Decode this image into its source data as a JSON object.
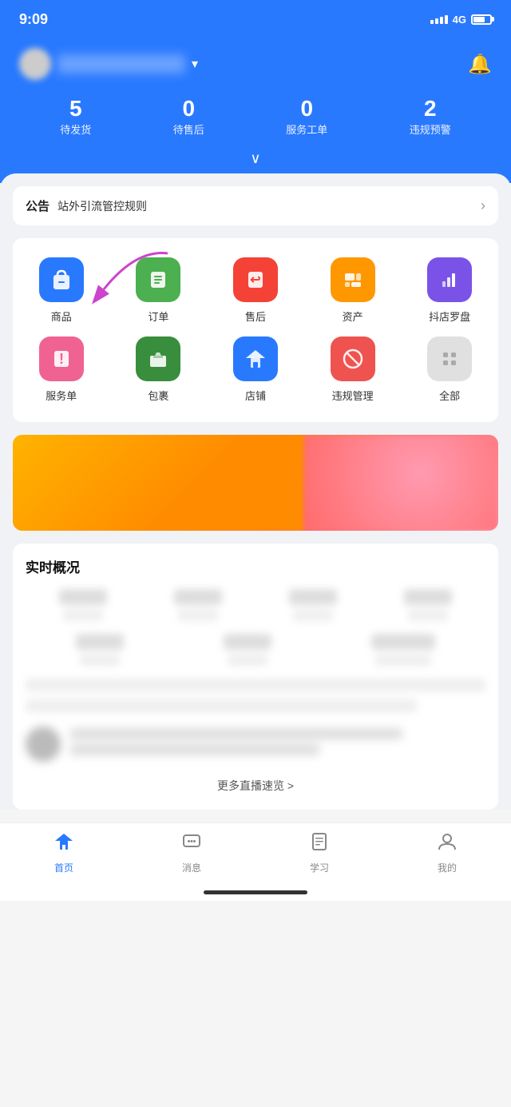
{
  "statusBar": {
    "time": "9:09",
    "signal": "4G"
  },
  "header": {
    "shopName": "店铺名称",
    "notificationAriaLabel": "通知",
    "chevronLabel": "展开"
  },
  "stats": [
    {
      "key": "pending_ship",
      "num": "5",
      "label": "待发货"
    },
    {
      "key": "pending_after",
      "num": "0",
      "label": "待售后"
    },
    {
      "key": "service_order",
      "num": "0",
      "label": "服务工单"
    },
    {
      "key": "violation_warning",
      "num": "2",
      "label": "违规预警"
    }
  ],
  "announcement": {
    "badge": "公告",
    "text": "站外引流管控规则",
    "arrowLabel": ">"
  },
  "menuItems": [
    [
      {
        "id": "goods",
        "label": "商品",
        "iconColor": "blue",
        "iconType": "bag"
      },
      {
        "id": "order",
        "label": "订单",
        "iconColor": "green",
        "iconType": "list"
      },
      {
        "id": "aftersale",
        "label": "售后",
        "iconColor": "red",
        "iconType": "return"
      },
      {
        "id": "assets",
        "label": "资产",
        "iconColor": "orange",
        "iconType": "asset"
      },
      {
        "id": "compass",
        "label": "抖店罗盘",
        "iconColor": "purple",
        "iconType": "compass"
      }
    ],
    [
      {
        "id": "service",
        "label": "服务单",
        "iconColor": "pink",
        "iconType": "service"
      },
      {
        "id": "package",
        "label": "包裹",
        "iconColor": "darkgreen",
        "iconType": "package"
      },
      {
        "id": "store",
        "label": "店铺",
        "iconColor": "house",
        "iconType": "shop"
      },
      {
        "id": "violation",
        "label": "违规管理",
        "iconColor": "forbidden",
        "iconType": "violation"
      },
      {
        "id": "all",
        "label": "全部",
        "iconColor": "gray",
        "iconType": "all"
      }
    ]
  ],
  "realtimeSection": {
    "title": "实时概况",
    "footerText": "更多直播速览 >"
  },
  "bottomNav": [
    {
      "id": "home",
      "label": "首页",
      "active": true,
      "icon": "home"
    },
    {
      "id": "message",
      "label": "消息",
      "active": false,
      "icon": "message"
    },
    {
      "id": "learn",
      "label": "学习",
      "active": false,
      "icon": "learn"
    },
    {
      "id": "mine",
      "label": "我的",
      "active": false,
      "icon": "user"
    }
  ]
}
